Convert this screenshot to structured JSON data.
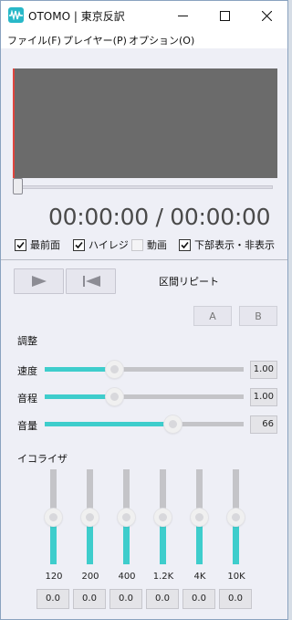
{
  "window": {
    "title": "OTOMO | 東京反訳",
    "app_icon": "waveform-icon",
    "accent": "#3ecdcc"
  },
  "menu": [
    {
      "label": "ファイル(F)"
    },
    {
      "label": "プレイヤー(P)"
    },
    {
      "label": "オプション(O)"
    }
  ],
  "player": {
    "time_display": "00:00:00 / 00:00:00",
    "seek_fraction": 0
  },
  "options": [
    {
      "label": "最前面",
      "checked": true,
      "enabled": true
    },
    {
      "label": "ハイレジ",
      "checked": true,
      "enabled": true
    },
    {
      "label": "動画",
      "checked": false,
      "enabled": false
    },
    {
      "label": "下部表示・非表示",
      "checked": true,
      "enabled": true
    }
  ],
  "transport": {
    "play_icon": "play-icon",
    "rewind_icon": "skip-to-start-icon"
  },
  "repeat": {
    "label": "区間リピート",
    "a_label": "A",
    "b_label": "B"
  },
  "adjust": {
    "label": "調整",
    "sliders": [
      {
        "label": "速度",
        "value": "1.00",
        "fraction": 0.35
      },
      {
        "label": "音程",
        "value": "1.00",
        "fraction": 0.35
      },
      {
        "label": "音量",
        "value": "66",
        "fraction": 0.64
      }
    ]
  },
  "equalizer": {
    "label": "イコライザ",
    "bands": [
      {
        "freq": "120",
        "value": "0.0",
        "fraction": 0.5
      },
      {
        "freq": "200",
        "value": "0.0",
        "fraction": 0.5
      },
      {
        "freq": "400",
        "value": "0.0",
        "fraction": 0.5
      },
      {
        "freq": "1.2K",
        "value": "0.0",
        "fraction": 0.5
      },
      {
        "freq": "4K",
        "value": "0.0",
        "fraction": 0.5
      },
      {
        "freq": "10K",
        "value": "0.0",
        "fraction": 0.5
      }
    ]
  }
}
